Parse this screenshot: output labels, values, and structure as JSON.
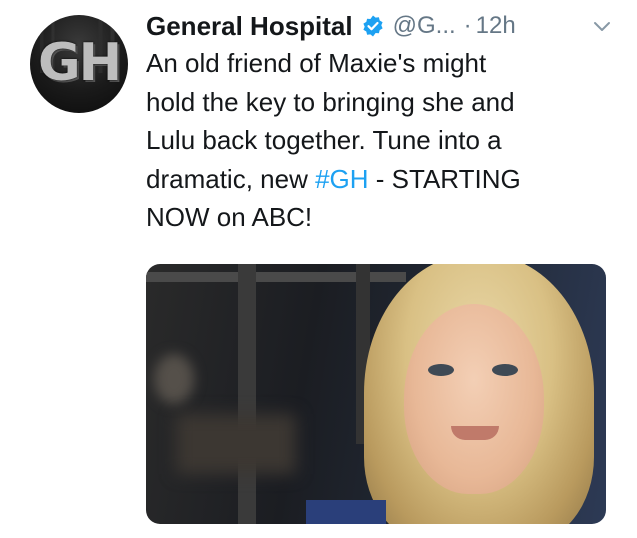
{
  "profile": {
    "avatar_text": "GH",
    "name": "General Hospital",
    "handle": "@G...",
    "separator": "·",
    "time": "12h"
  },
  "tweet": {
    "text_before": "An old friend of Maxie's might\nhold the key to bringing she and\nLulu back together. Tune into a\ndramatic, new ",
    "hashtag": "#GH",
    "text_after": " - STARTING\nNOW on ABC!"
  },
  "colors": {
    "verified": "#1da1f2",
    "link": "#1da1f2",
    "muted": "#657786",
    "text": "#14171a"
  },
  "icons": {
    "verified": "verified-badge-icon",
    "caret": "chevron-down-icon"
  }
}
